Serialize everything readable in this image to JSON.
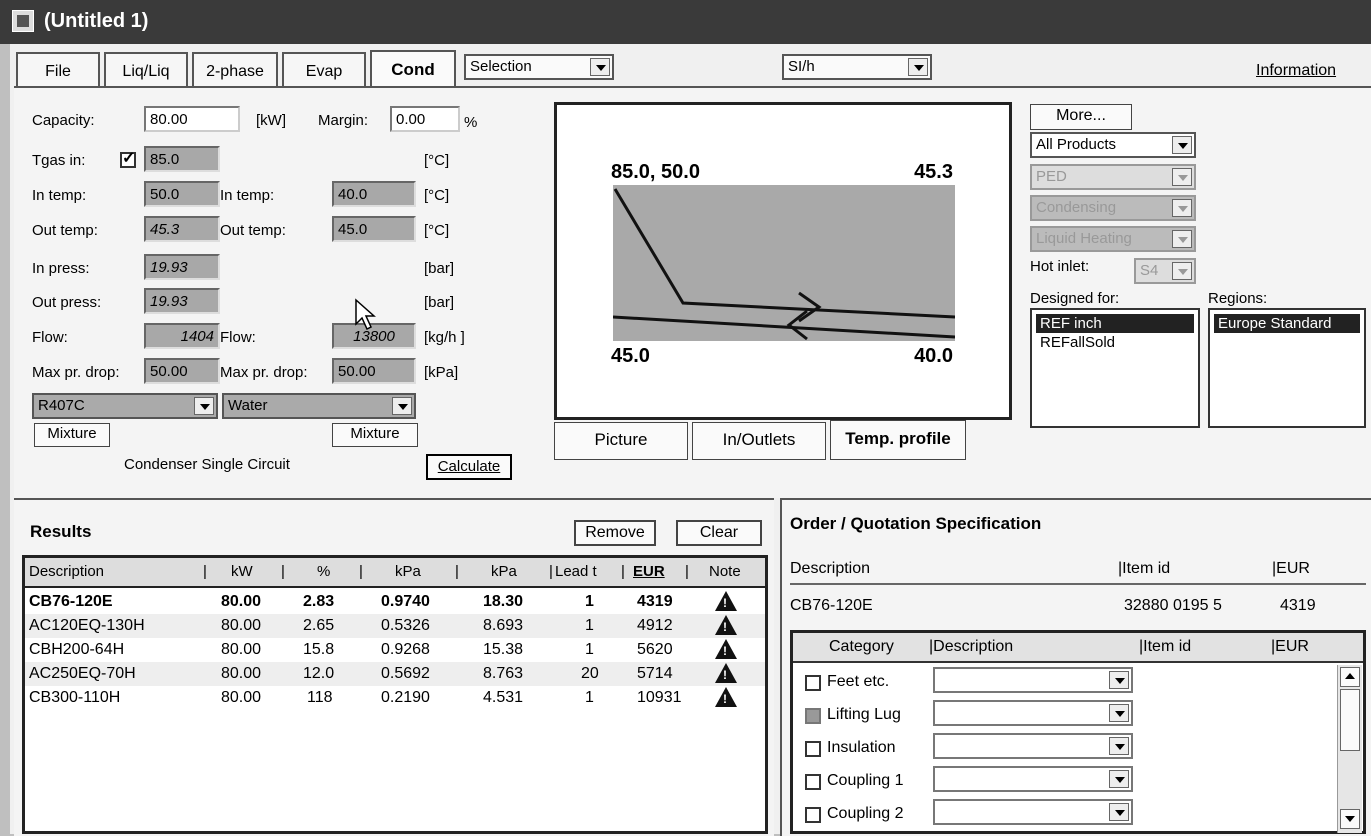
{
  "window": {
    "title": "(Untitled 1)"
  },
  "tabs": [
    {
      "label": "File"
    },
    {
      "label": "Liq/Liq"
    },
    {
      "label": "2-phase"
    },
    {
      "label": "Evap"
    },
    {
      "label": "Cond"
    }
  ],
  "toolbar": {
    "selection": "Selection",
    "units": "SI/h",
    "information": "Information"
  },
  "inputs": {
    "capacity_label": "Capacity:",
    "capacity": "80.00",
    "capacity_unit": "[kW]",
    "margin_label": "Margin:",
    "margin": "0.00",
    "margin_unit": "%",
    "tgas_label": "Tgas in:",
    "tgas": "85.0",
    "tgas_unit": "[°C]",
    "in_temp_label": "In temp:",
    "in_temp_1": "50.0",
    "in_temp_2": "40.0",
    "in_temp_unit": "[°C]",
    "out_temp_label": "Out temp:",
    "out_temp_1": "45.3",
    "out_temp_2": "45.0",
    "out_temp_unit": "[°C]",
    "in_press_label": "In press:",
    "in_press": "19.93",
    "in_press_unit": "[bar]",
    "out_press_label": "Out press:",
    "out_press": "19.93",
    "out_press_unit": "[bar]",
    "flow_label": "Flow:",
    "flow_1": "1404",
    "flow_2": "13800",
    "flow_unit": "[kg/h ]",
    "max_drop_label": "Max pr. drop:",
    "max_drop_1": "50.00",
    "max_drop_2": "50.00",
    "max_drop_unit": "[kPa]",
    "fluid_1": "R407C",
    "fluid_2": "Water",
    "mixture": "Mixture",
    "type_text": "Condenser Single Circuit",
    "calculate": "Calculate"
  },
  "graph": {
    "top_left": "85.0,  50.0",
    "top_right": "45.3",
    "bottom_left": "45.0",
    "bottom_right": "40.0",
    "tabs": [
      "Picture",
      "In/Outlets",
      "Temp. profile"
    ],
    "bg_color": "#a9a9a9"
  },
  "product_filters": {
    "more": "More...",
    "product": "All Products",
    "ped": "PED",
    "condensing": "Condensing",
    "liquid_heating": "Liquid Heating",
    "hot_inlet_label": "Hot inlet:",
    "hot_inlet": "S4",
    "designed_for_label": "Designed for:",
    "designed_for": [
      "REF inch",
      "REFallSold"
    ],
    "regions_label": "Regions:",
    "regions": [
      "Europe Standard"
    ]
  },
  "results": {
    "title": "Results",
    "remove": "Remove",
    "clear": "Clear",
    "headers": [
      "Description",
      "kW",
      "%",
      "kPa",
      "kPa",
      "Lead t",
      "EUR",
      "Note"
    ],
    "rows": [
      [
        "CB76-120E",
        "80.00",
        "2.83",
        "0.9740",
        "18.30",
        "1",
        "4319"
      ],
      [
        "AC120EQ-130H",
        "80.00",
        "2.65",
        "0.5326",
        "8.693",
        "1",
        "4912"
      ],
      [
        "CBH200-64H",
        "80.00",
        "15.8",
        "0.9268",
        "15.38",
        "1",
        "5620"
      ],
      [
        "AC250EQ-70H",
        "80.00",
        "12.0",
        "0.5692",
        "8.763",
        "20",
        "5714"
      ],
      [
        "CB300-110H",
        "80.00",
        "118",
        "0.2190",
        "4.531",
        "1",
        "10931"
      ]
    ]
  },
  "order": {
    "title": "Order / Quotation Specification",
    "headers": [
      "Description",
      "|Item id",
      "|EUR"
    ],
    "row": [
      "CB76-120E",
      "32880 0195 5",
      "4319"
    ],
    "acc_headers": [
      "Category",
      "|Description",
      "|Item id",
      "|EUR"
    ],
    "accessories": [
      "Feet etc.",
      "Lifting Lug",
      "Insulation",
      "Coupling 1",
      "Coupling 2"
    ]
  }
}
